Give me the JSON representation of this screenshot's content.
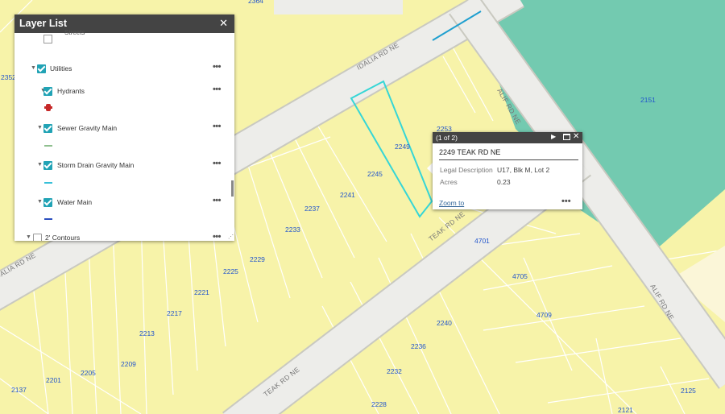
{
  "map": {
    "road_labels": [
      "IDALIA RD NE",
      "IDALIA RD NE",
      "ALIF RD NE",
      "ALIF RD NE",
      "TEAK RD NE",
      "TEAK RD NE"
    ],
    "parcel_labels": [
      "2364",
      "2352",
      "2253",
      "2249",
      "2245",
      "2241",
      "2237",
      "2233",
      "2229",
      "2225",
      "2221",
      "2217",
      "2213",
      "2209",
      "2205",
      "2201",
      "2137",
      "4701",
      "4705",
      "4709",
      "2240",
      "2236",
      "2232",
      "2228",
      "2121",
      "2125",
      "2151"
    ],
    "colors": {
      "parcel_fill": "#f7f3a9",
      "road": "#e9e9e4",
      "park": "#73cab0",
      "selection": "#36d6d6",
      "label": "#2255cc"
    }
  },
  "layer_list": {
    "title": "Layer List",
    "close_icon": "✕",
    "cut_off_text": "Streets",
    "more_icon": "•••",
    "items": [
      {
        "label": "Utilities",
        "checked": true
      },
      {
        "label": "Hydrants",
        "checked": true
      },
      {
        "label": "Sewer Gravity Main",
        "checked": true
      },
      {
        "label": "Storm Drain Gravity Main",
        "checked": true
      },
      {
        "label": "Water Main",
        "checked": true
      },
      {
        "label": "2' Contours",
        "checked": false
      }
    ],
    "legend_colors": {
      "hydrant": "#c62828",
      "sewer": "#8fbf8f",
      "storm": "#38c0d8",
      "water": "#2b4fbf"
    }
  },
  "popup": {
    "count": "(1 of 2)",
    "next_icon": "▶",
    "close_icon": "✕",
    "title": "2249 TEAK RD NE",
    "attributes": [
      {
        "name": "Legal Description",
        "value": "U17, Blk M, Lot 2"
      },
      {
        "name": "Acres",
        "value": "0.23"
      }
    ],
    "zoom_link": "Zoom to",
    "more_icon": "•••"
  }
}
